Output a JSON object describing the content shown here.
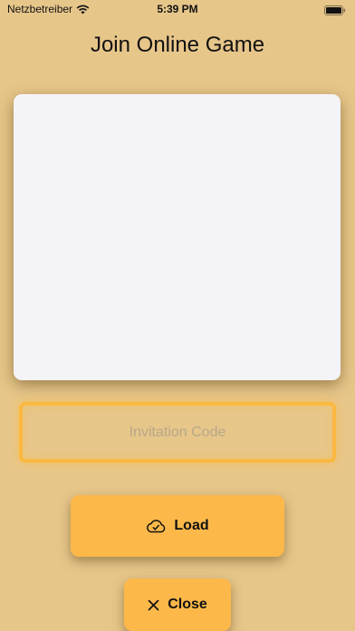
{
  "status_bar": {
    "carrier": "Netzbetreiber",
    "time": "5:39 PM",
    "icons": [
      "wifi-icon",
      "battery-icon"
    ]
  },
  "title": "Join Online Game",
  "code_input": {
    "placeholder": "Invitation Code",
    "value": ""
  },
  "buttons": {
    "load_label": "Load",
    "load_icon": "cloud-check-icon",
    "close_label": "Close",
    "close_icon": "close-icon"
  },
  "colors": {
    "background": "#e7c68a",
    "accent": "#fdb84a",
    "field_border": "#fbb841",
    "panel": "#f4f3f8"
  }
}
